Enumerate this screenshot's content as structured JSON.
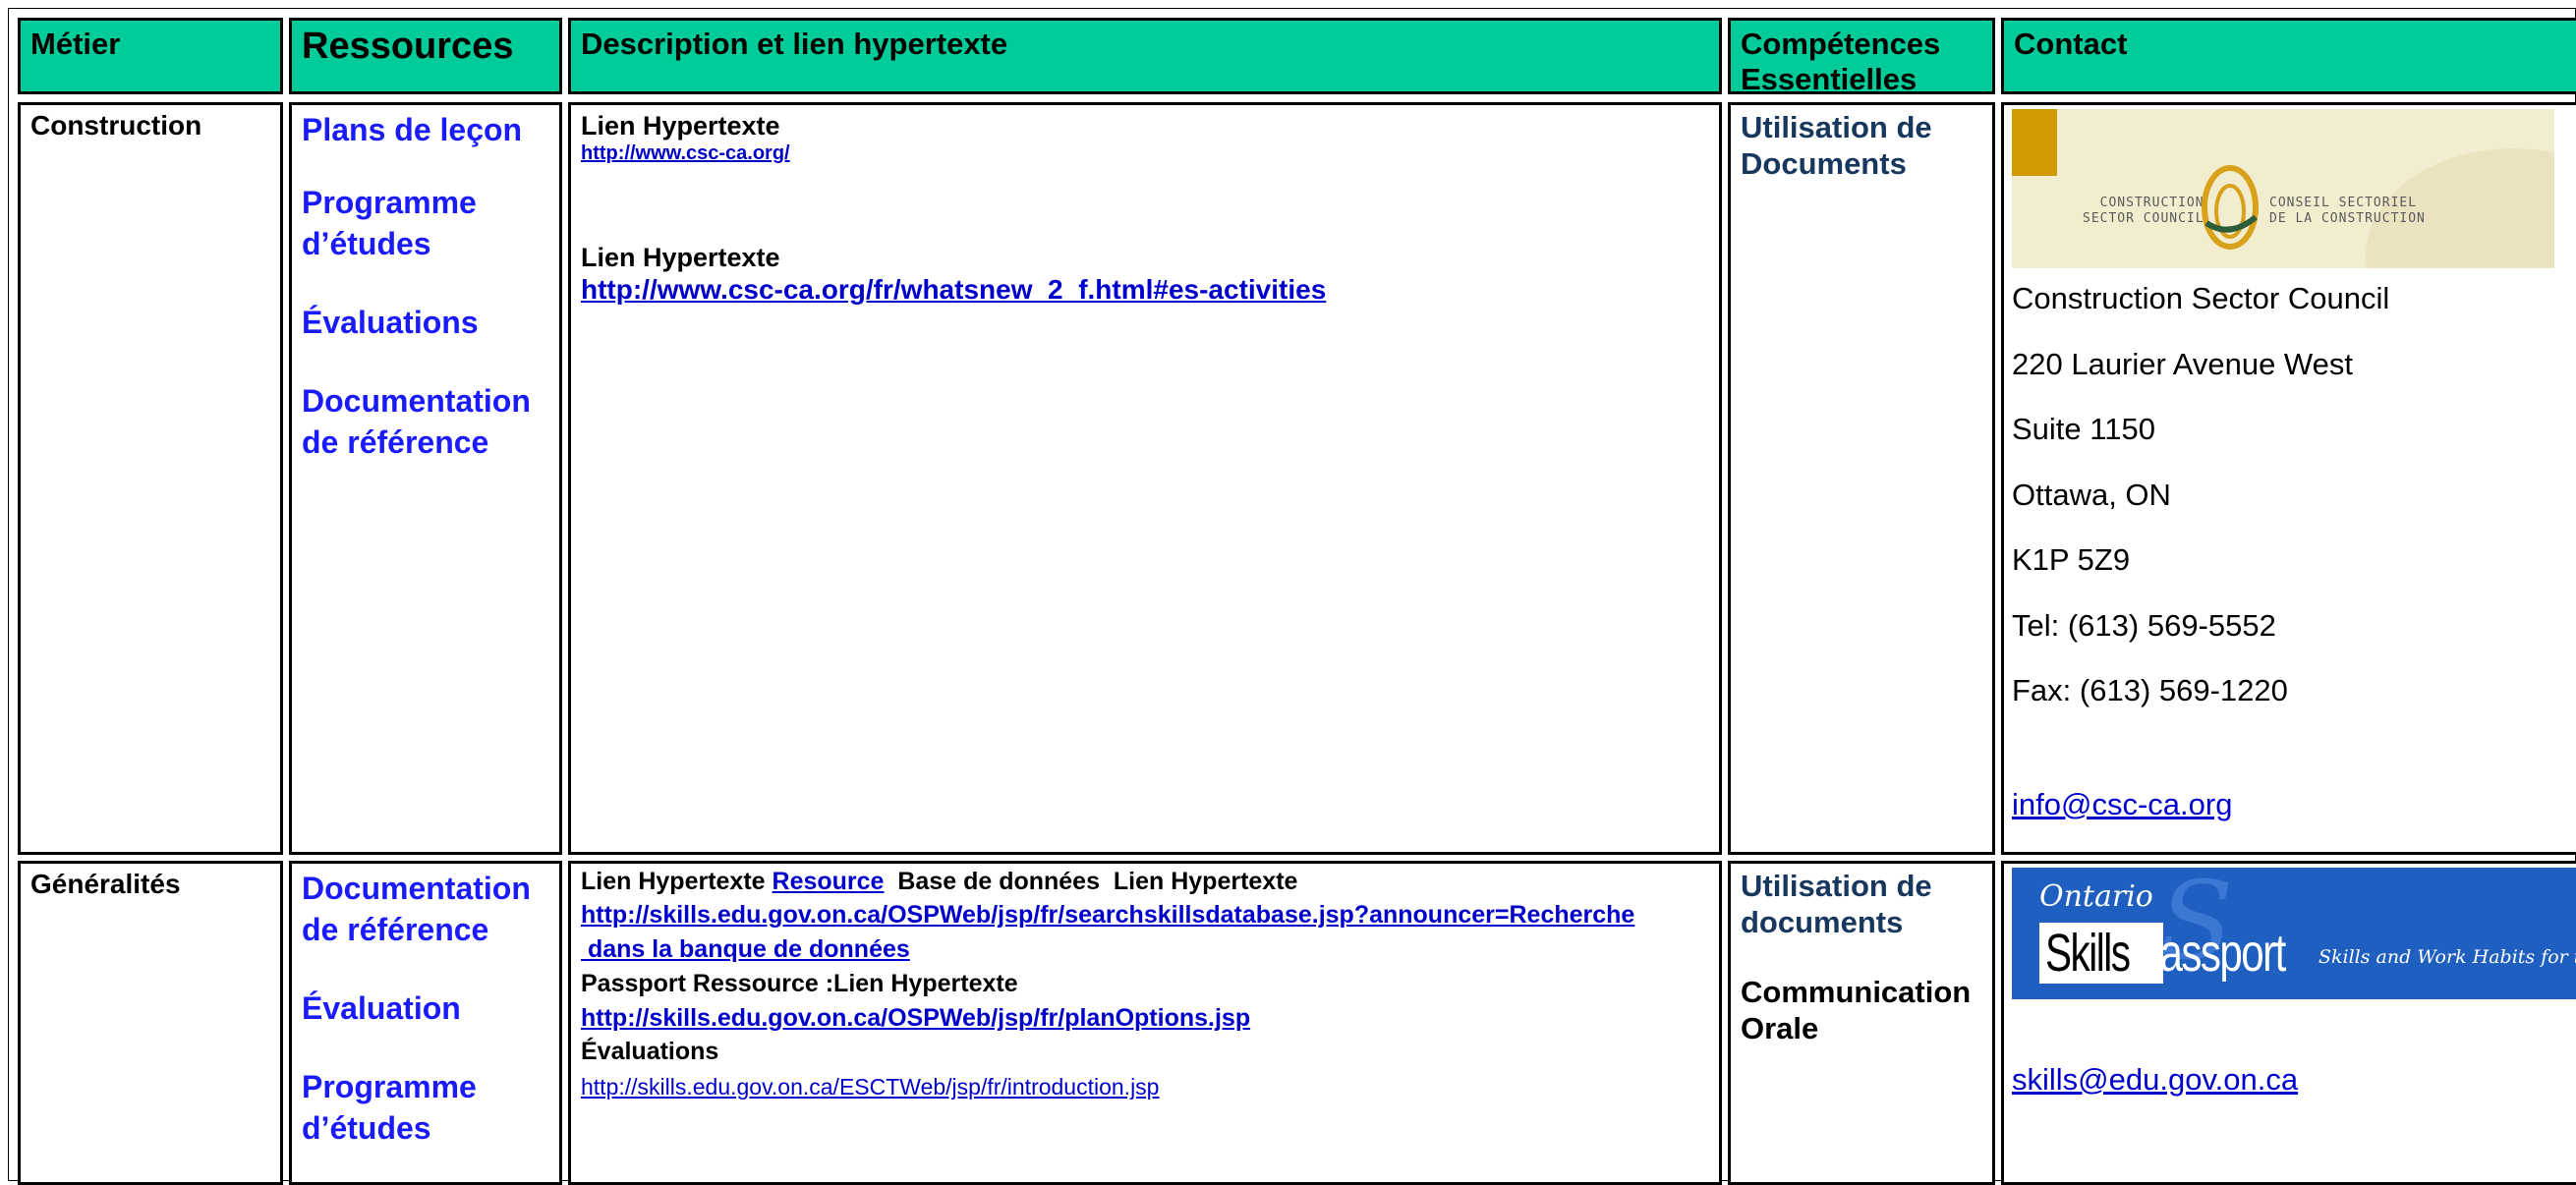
{
  "header": {
    "col_metier": "Métier",
    "col_ressources": "Ressources",
    "col_description": "Description et lien hypertexte",
    "col_competences_1": "Compétences",
    "col_competences_2": "Essentielles",
    "col_contact": "Contact"
  },
  "row1": {
    "metier": "Construction",
    "resources": {
      "r1": "Plans de leçon",
      "r2a": "Programme",
      "r2b": "d’études",
      "r3": "Évaluations",
      "r4a": "Documentation",
      "r4b": "de référence"
    },
    "description": {
      "label1": "Lien Hypertexte",
      "url1": "http://www.csc-ca.org/",
      "label2": "Lien Hypertexte",
      "url2": "http://www.csc-ca.org/fr/whatsnew_2_f.html#es-activities"
    },
    "competences": {
      "c1a": "Utilisation de",
      "c1b": "Documents"
    },
    "contact": {
      "logo_left_1": "CONSTRUCTION",
      "logo_left_2": "SECTOR COUNCIL",
      "logo_right_1": "CONSEIL SECTORIEL",
      "logo_right_2": "DE LA CONSTRUCTION",
      "name": "Construction Sector Council",
      "street": "220 Laurier Avenue West",
      "suite": "Suite 1150",
      "city": "Ottawa, ON",
      "postal": "K1P 5Z9",
      "tel": "Tel: (613) 569-5552",
      "fax": "Fax: (613) 569-1220",
      "email": "info@csc-ca.org"
    }
  },
  "row2": {
    "metier": "Généralités",
    "resources": {
      "r1a": "Documentation",
      "r1b": "de référence",
      "r2": "Évaluation",
      "r3a": "Programme",
      "r3b": "d’études"
    },
    "description": {
      "line1_a": "Lien Hypertexte ",
      "line1_link": "Resource",
      "line1_b": "  Base de données  Lien Hypertexte",
      "url1a": "http://skills.edu.gov.on.ca/OSPWeb/jsp/fr/searchskillsdatabase.jsp?announcer=Recherche",
      "url1b": " dans la banque de données",
      "line2": "Passport Ressource :Lien Hypertexte",
      "url2": "http://skills.edu.gov.on.ca/OSPWeb/jsp/fr/planOptions.jsp",
      "line3": "Évaluations",
      "url3": "http://skills.edu.gov.on.ca/ESCTWeb/jsp/fr/introduction.jsp"
    },
    "competences": {
      "c1a": "Utilisation de",
      "c1b": "documents",
      "c2a": "Communication",
      "c2b": "Orale"
    },
    "contact": {
      "logo_ontario": "Ontario",
      "logo_skills": "Skills",
      "logo_passport": "Passport",
      "logo_tagline": "Skills and Work Habits for the Workplace",
      "email": "skills@edu.gov.on.ca"
    }
  },
  "colors": {
    "header_bg": "#00cc99",
    "resource_blue": "#1a1aff",
    "competence_navy": "#17375e",
    "link": "#0000cc"
  }
}
